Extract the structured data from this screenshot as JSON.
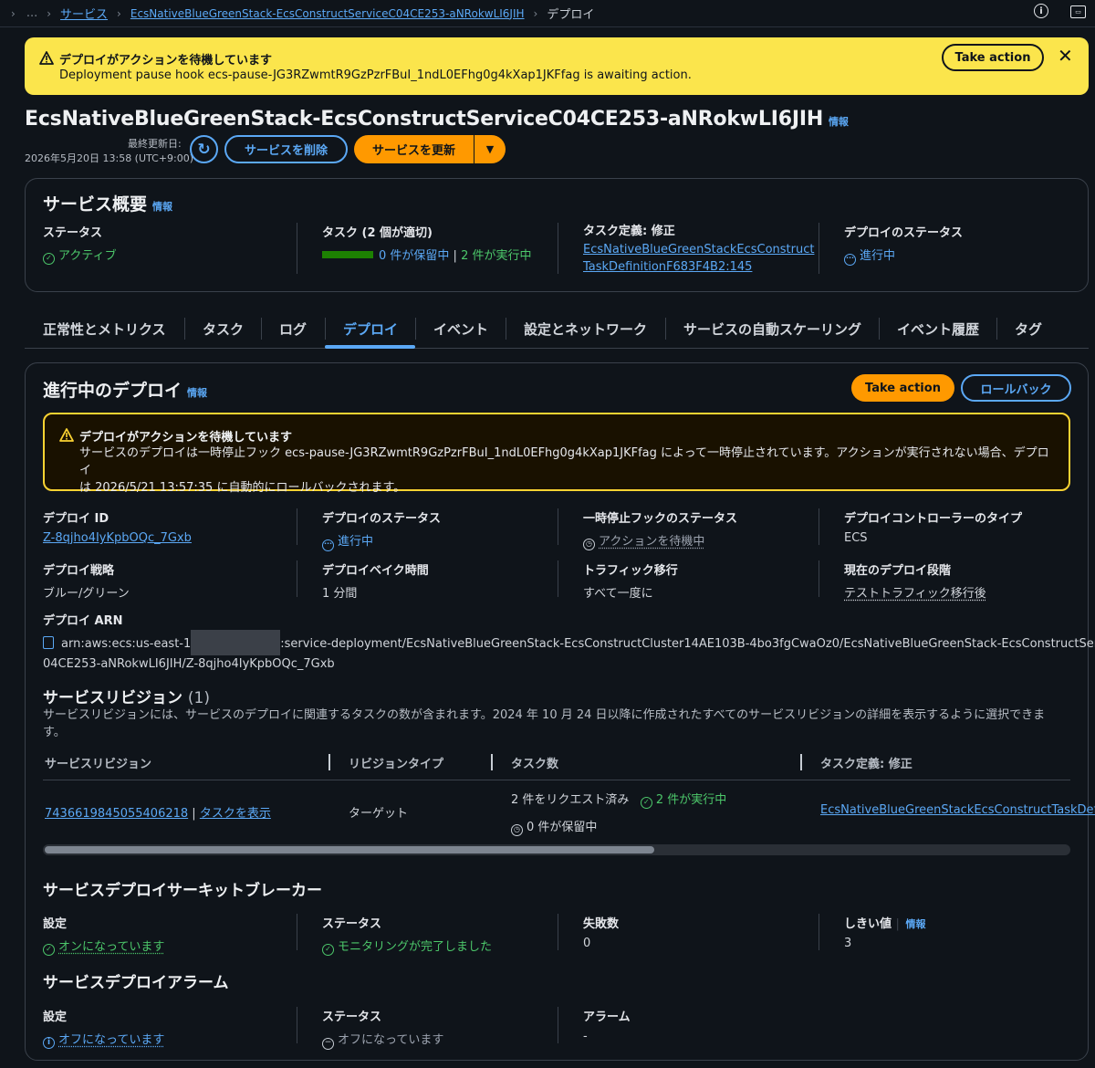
{
  "breadcrumb": {
    "ellipsis": "...",
    "items": [
      "サービス",
      "EcsNativeBlueGreenStack-EcsConstructServiceC04CE253-aNRokwLI6JIH"
    ],
    "current": "デプロイ"
  },
  "topbar_icons": [
    "info-icon",
    "screen-icon"
  ],
  "flash": {
    "title": "デプロイがアクションを待機しています",
    "message": "Deployment pause hook ecs-pause-JG3RZwmtR9GzPzrFBuI_1ndL0EFhg0g4kXap1JKFfag is awaiting action.",
    "action_label": "Take action",
    "close": "✕"
  },
  "page": {
    "title": "EcsNativeBlueGreenStack-EcsConstructServiceC04CE253-aNRokwLI6JIH",
    "info": "情報",
    "last_updated_label": "最終更新日:",
    "last_updated": "2026年5月20日 13:58 (UTC+9:00)",
    "delete_label": "サービスを削除",
    "update_label": "サービスを更新"
  },
  "overview": {
    "title": "サービス概要",
    "info": "情報",
    "status_label": "ステータス",
    "status_value": "アクティブ",
    "tasks_label": "タスク (2 個が適切)",
    "tasks_pending": "0 件が保留中",
    "tasks_sep": "|",
    "tasks_running": "2 件が実行中",
    "taskdef_label": "タスク定義: 修正",
    "taskdef_line1": "EcsNativeBlueGreenStackEcsConstruct",
    "taskdef_line2": "TaskDefinitionF683F4B2:145",
    "deploy_status_label": "デプロイのステータス",
    "deploy_status_value": "進行中"
  },
  "tabs": [
    "正常性とメトリクス",
    "タスク",
    "ログ",
    "デプロイ",
    "イベント",
    "設定とネットワーク",
    "サービスの自動スケーリング",
    "イベント履歴",
    "タグ"
  ],
  "active_tab": "デプロイ",
  "deployment": {
    "title": "進行中のデプロイ",
    "info": "情報",
    "take_action": "Take action",
    "rollback": "ロールバック",
    "alert_title": "デプロイがアクションを待機しています",
    "alert_line1": "サービスのデプロイは一時停止フック ecs-pause-JG3RZwmtR9GzPzrFBuI_1ndL0EFhg0g4kXap1JKFfag によって一時停止されています。アクションが実行されない場合、デプロイ",
    "alert_line2": "は 2026/5/21 13:57:35 に自動的にロールバックされます。",
    "id_label": "デプロイ ID",
    "id_value": "Z-8qjho4IyKpbOQc_7Gxb",
    "status_label": "デプロイのステータス",
    "status_value": "進行中",
    "hook_label": "一時停止フックのステータス",
    "hook_value": "アクションを待機中",
    "controller_label": "デプロイコントローラーのタイプ",
    "controller_value": "ECS",
    "strategy_label": "デプロイ戦略",
    "strategy_value": "ブルー/グリーン",
    "bake_label": "デプロイベイク時間",
    "bake_value": "1 分間",
    "traffic_label": "トラフィック移行",
    "traffic_value": "すべて一度に",
    "stage_label": "現在のデプロイ段階",
    "stage_value": "テストトラフィック移行後",
    "arn_label": "デプロイ ARN",
    "arn_prefix": "arn:aws:ecs:us-east-1",
    "arn_rest": ":service-deployment/EcsNativeBlueGreenStack-EcsConstructCluster14AE103B-4bo3fgCwaOz0/EcsNativeBlueGreenStack-EcsConstructServiceC",
    "arn_line2": "04CE253-aNRokwLI6JIH/Z-8qjho4IyKpbOQc_7Gxb"
  },
  "revisions": {
    "title": "サービスリビジョン",
    "count": "(1)",
    "desc_line1": "サービスリビジョンには、サービスのデプロイに関連するタスクの数が含まれます。2024 年 10 月 24 日以降に作成されたすべてのサービスリビジョンの詳細を表示するように選択できま",
    "desc_line2": "す。",
    "columns": [
      "サービスリビジョン",
      "リビジョンタイプ",
      "タスク数",
      "タスク定義: 修正"
    ],
    "row": {
      "revision": "7436619845055406218",
      "sep": "|",
      "show_tasks": "タスクを表示",
      "type": "ターゲット",
      "requested": "2 件をリクエスト済み",
      "running": "2 件が実行中",
      "pending": "0 件が保留中",
      "taskdef": "EcsNativeBlueGreenStackEcsConstructTaskDef"
    }
  },
  "breaker": {
    "title": "サービスデプロイサーキットブレーカー",
    "setting_label": "設定",
    "setting_value": "オンになっています",
    "status_label": "ステータス",
    "status_value": "モニタリングが完了しました",
    "failures_label": "失敗数",
    "failures_value": "0",
    "threshold_label": "しきい値",
    "threshold_info": "情報",
    "threshold_value": "3"
  },
  "alarms": {
    "title": "サービスデプロイアラーム",
    "setting_label": "設定",
    "setting_value": "オフになっています",
    "status_label": "ステータス",
    "status_value": "オフになっています",
    "alarm_label": "アラーム",
    "alarm_value": "-"
  }
}
